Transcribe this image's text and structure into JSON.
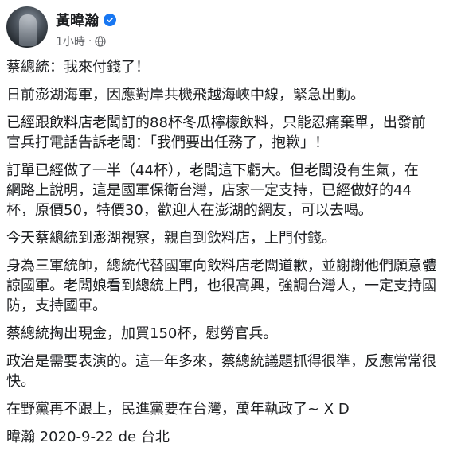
{
  "post": {
    "author": "黃暐瀚",
    "time": "1小時",
    "separator": "·",
    "paragraphs": [
      "蔡總統：我來付錢了！",
      "日前澎湖海軍，因應對岸共機飛越海峽中線，緊急出動。",
      "已經跟飲料店老闆訂的88杯冬瓜檸檬飲料，只能忍痛棄單，出發前\n官兵打電話告訴老闆：「我們要出任務了，抱歉」！",
      "訂單已經做了一半（44杯），老闆這下虧大。但老闆没有生氣，在\n網路上說明，這是國軍保衛台灣，店家一定支持，已經做好的44\n杯，原價50，特價30，歡迎人在澎湖的網友，可以去喝。",
      "今天蔡總統到澎湖視察，親自到飲料店，上門付錢。",
      "身為三軍統帥，總統代替國軍向飲料店老闆道歉，並謝謝他們願意體\n諒國軍。老闆娘看到總統上門，也很高興，強調台灣人，一定支持國\n防，支持國軍。",
      "蔡總統掏出現金，加買150杯，慰勞官兵。",
      "政治是需要表演的。這一年多來，蔡總統議題抓得很準，反應常常很\n快。",
      "在野黨再不跟上，民進黨要在台灣，萬年執政了~ X D",
      "暐瀚 2020-9-22 de 台北"
    ]
  },
  "icons": {
    "verified": "verified-badge-icon",
    "audience": "globe-icon"
  },
  "colors": {
    "verified": "#1877f2",
    "text": "#1c1e21",
    "meta": "#65676b"
  }
}
